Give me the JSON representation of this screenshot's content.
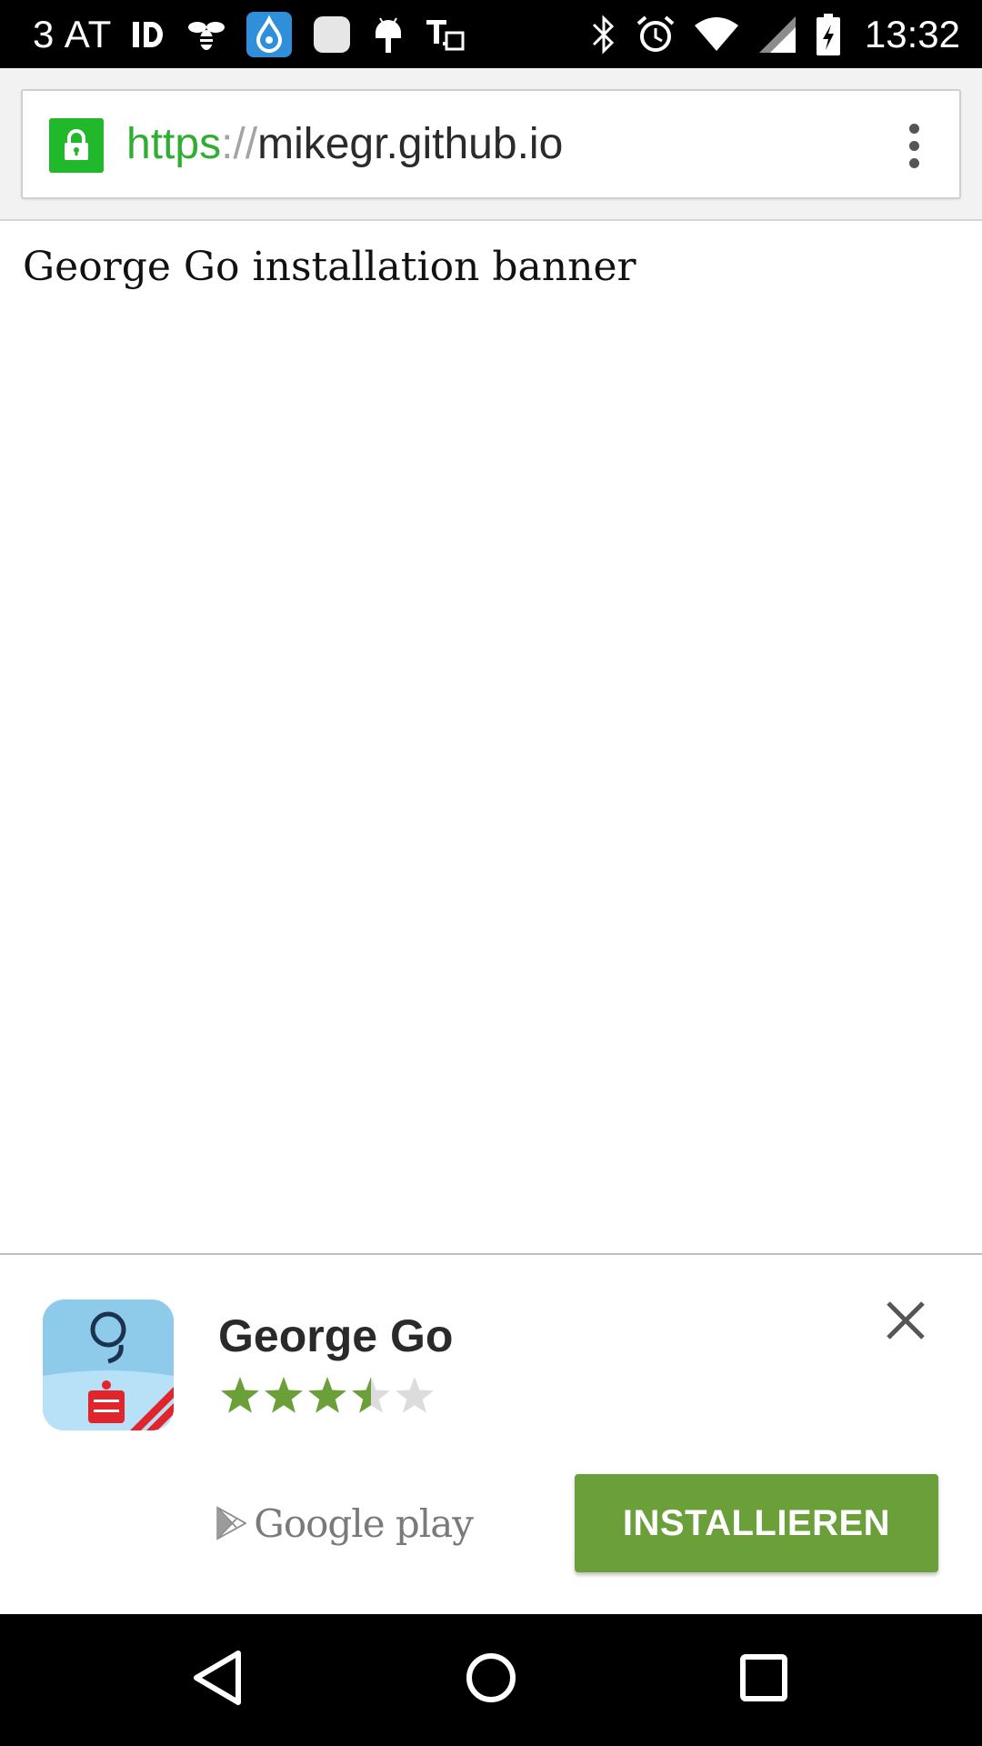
{
  "status_bar": {
    "carrier": "3 AT",
    "time": "13:32",
    "icons": [
      "id-icon",
      "bee-icon",
      "water-drop-app-icon",
      "blank-app-icon",
      "android-icon",
      "text-selection-icon",
      "bluetooth-icon",
      "alarm-icon",
      "wifi-icon",
      "signal-icon",
      "battery-charging-icon"
    ]
  },
  "browser": {
    "url_scheme": "https",
    "url_separator": "://",
    "url_host": "mikegr.github.io",
    "secure_icon": "lock-icon",
    "menu_icon": "overflow-menu-icon"
  },
  "page": {
    "title": "George Go installation banner"
  },
  "install_banner": {
    "app_name": "George Go",
    "rating": 3.5,
    "rating_max": 5,
    "store_label": "Google play",
    "install_label": "INSTALLIEREN",
    "close_icon": "close-icon",
    "colors": {
      "install_button": "#6b9f3a",
      "star_filled": "#6b9f3a",
      "star_empty": "#dcdcdc"
    }
  },
  "nav_bar": {
    "icons": [
      "back-icon",
      "home-icon",
      "recents-icon"
    ]
  }
}
